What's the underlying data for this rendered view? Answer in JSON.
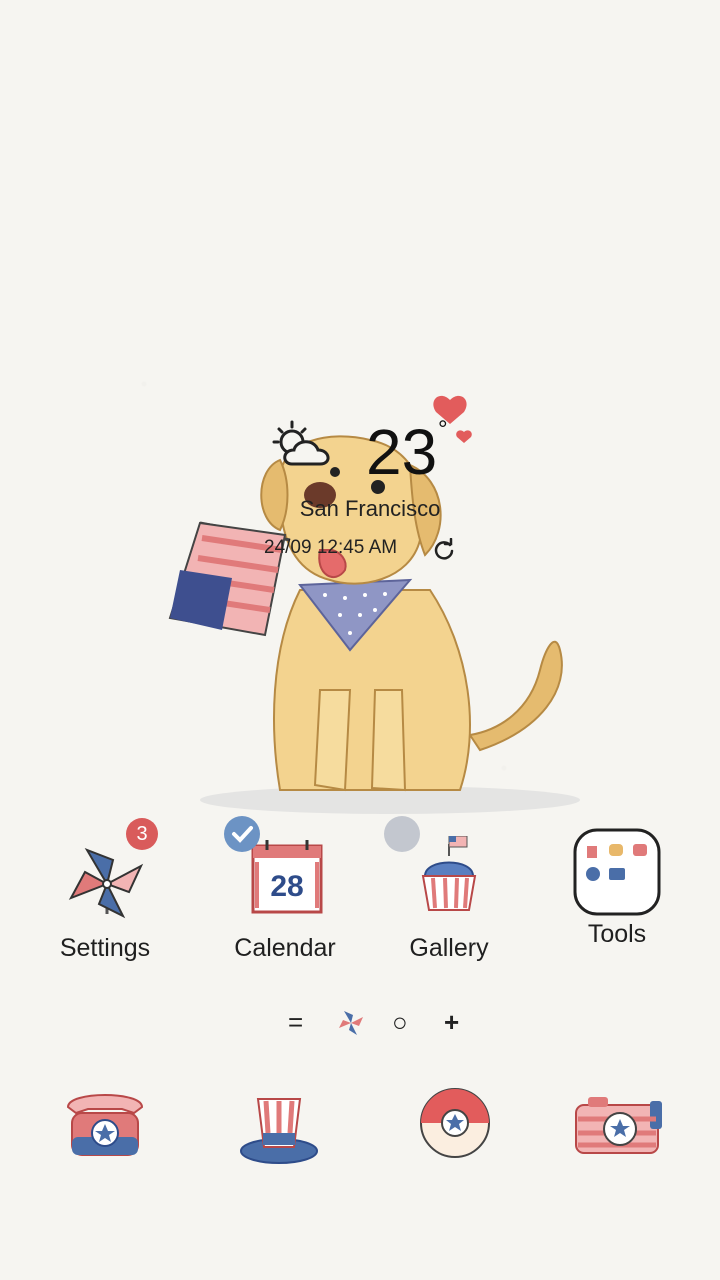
{
  "weather": {
    "temperature": "23",
    "degree": "°",
    "city": "San Francisco",
    "datetime": "24/09 12:45 AM",
    "icon": "partly-cloudy-icon"
  },
  "apps": [
    {
      "label": "Settings",
      "icon": "pinwheel-icon",
      "badge": "3"
    },
    {
      "label": "Calendar",
      "icon": "calendar-icon",
      "date": "28"
    },
    {
      "label": "Gallery",
      "icon": "cupcake-icon"
    },
    {
      "label": "Tools",
      "icon": "tools-folder-icon"
    }
  ],
  "pager": {
    "items": [
      "=",
      "pinwheel",
      "○",
      "+"
    ]
  },
  "dock": [
    {
      "icon": "phone-icon"
    },
    {
      "icon": "uncle-sam-hat-icon"
    },
    {
      "icon": "star-ball-icon"
    },
    {
      "icon": "camera-icon"
    }
  ],
  "colors": {
    "background": "#f6f5f1",
    "red": "#d95b5b",
    "blue": "#4a6ea8",
    "badge": "#d95b5b",
    "check": "#6c93c4"
  }
}
